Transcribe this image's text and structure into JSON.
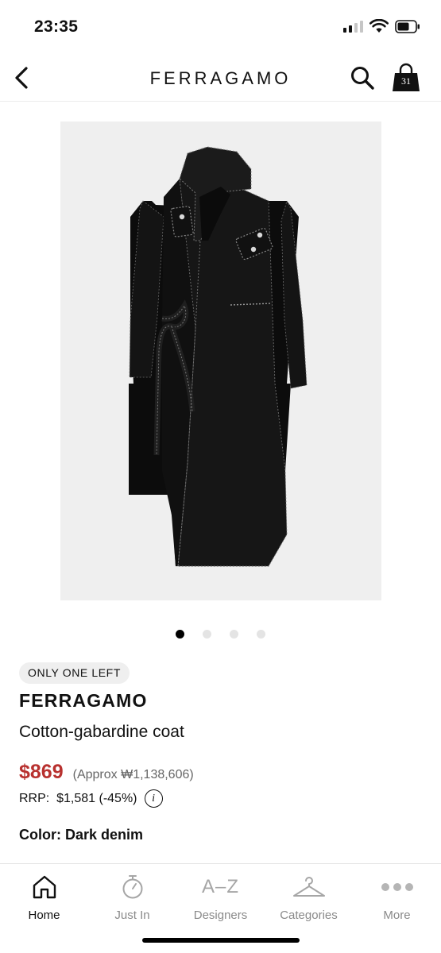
{
  "status_bar": {
    "time": "23:35",
    "icons": [
      "cellular-signal-icon",
      "wifi-icon",
      "battery-icon"
    ]
  },
  "header": {
    "title": "FERRAGAMO",
    "bag_count": "31",
    "icons": [
      "back-arrow-icon",
      "search-icon",
      "shopping-bag-icon"
    ]
  },
  "gallery": {
    "dot_count": 4,
    "active_index": 0
  },
  "product": {
    "stock_badge": "ONLY ONE LEFT",
    "brand": "FERRAGAMO",
    "name": "Cotton-gabardine coat",
    "price": "$869",
    "approx": "(Approx ₩1,138,606)",
    "rrp": "RRP:  $1,581 (-45%)",
    "color": "Color: Dark denim"
  },
  "tabs": [
    {
      "label": "Home",
      "icon": "home-icon",
      "active": true
    },
    {
      "label": "Just In",
      "icon": "stopwatch-icon",
      "active": false
    },
    {
      "label": "Designers",
      "icon": "a-z-icon",
      "active": false
    },
    {
      "label": "Categories",
      "icon": "hanger-icon",
      "active": false
    },
    {
      "label": "More",
      "icon": "more-dots-icon",
      "active": false
    }
  ],
  "colors": {
    "price": "#b8312f",
    "badge_bg": "#efefef",
    "image_bg": "#efefef",
    "active_tab": "#111111",
    "inactive_tab": "#8a8a8a"
  }
}
